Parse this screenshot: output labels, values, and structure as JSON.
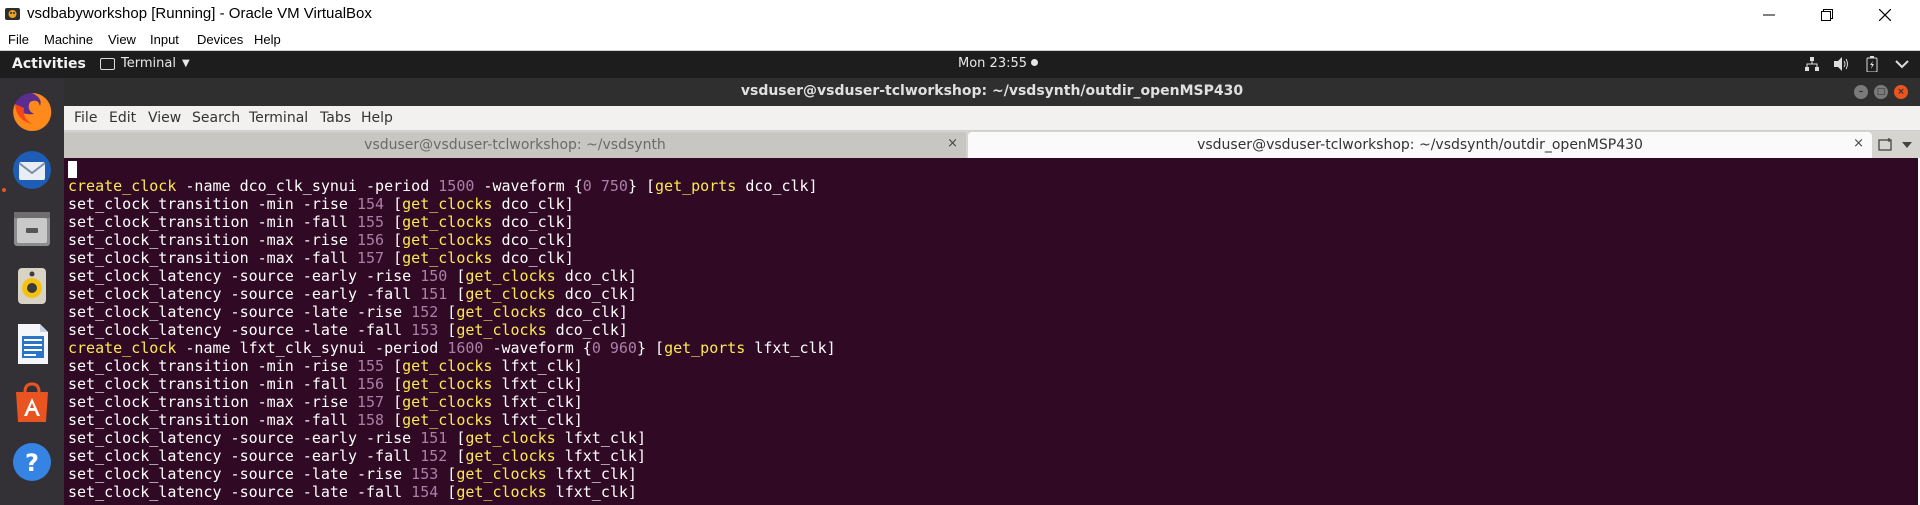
{
  "vbox": {
    "title": "vsdbabyworkshop [Running] - Oracle VM VirtualBox",
    "menu": [
      "File",
      "Machine",
      "View",
      "Input",
      "Devices",
      "Help"
    ]
  },
  "topbar": {
    "activities": "Activities",
    "app_menu": "Terminal",
    "clock": "Mon 23:55"
  },
  "dock": {
    "items": [
      "firefox-icon",
      "thunderbird-icon",
      "files-icon",
      "rhythmbox-icon",
      "libreoffice-writer-icon",
      "software-icon",
      "help-icon"
    ]
  },
  "terminal": {
    "window_title": "vsduser@vsduser-tclworkshop: ~/vsdsynth/outdir_openMSP430",
    "menu": [
      "File",
      "Edit",
      "View",
      "Search",
      "Terminal",
      "Tabs",
      "Help"
    ],
    "tabs": [
      {
        "label": "vsduser@vsduser-tclworkshop: ~/vsdsynth",
        "close": "×",
        "active": false
      },
      {
        "label": "vsduser@vsduser-tclworkshop: ~/vsdsynth/outdir_openMSP430",
        "close": "×",
        "active": true
      }
    ],
    "lines": [
      [
        {
          "t": "create_clock",
          "c": "cmd-kw"
        },
        {
          "t": " -name dco_clk_synui -period "
        },
        {
          "t": "1500",
          "c": "num"
        },
        {
          "t": " -waveform {"
        },
        {
          "t": "0 750",
          "c": "num"
        },
        {
          "t": "} ["
        },
        {
          "t": "get_ports",
          "c": "brk-kw"
        },
        {
          "t": " dco_clk]"
        }
      ],
      [
        {
          "t": "set_clock_transition -min -rise "
        },
        {
          "t": "154",
          "c": "num"
        },
        {
          "t": " ["
        },
        {
          "t": "get_clocks",
          "c": "brk-kw"
        },
        {
          "t": " dco_clk]"
        }
      ],
      [
        {
          "t": "set_clock_transition -min -fall "
        },
        {
          "t": "155",
          "c": "num"
        },
        {
          "t": " ["
        },
        {
          "t": "get_clocks",
          "c": "brk-kw"
        },
        {
          "t": " dco_clk]"
        }
      ],
      [
        {
          "t": "set_clock_transition -max -rise "
        },
        {
          "t": "156",
          "c": "num"
        },
        {
          "t": " ["
        },
        {
          "t": "get_clocks",
          "c": "brk-kw"
        },
        {
          "t": " dco_clk]"
        }
      ],
      [
        {
          "t": "set_clock_transition -max -fall "
        },
        {
          "t": "157",
          "c": "num"
        },
        {
          "t": " ["
        },
        {
          "t": "get_clocks",
          "c": "brk-kw"
        },
        {
          "t": " dco_clk]"
        }
      ],
      [
        {
          "t": "set_clock_latency -source -early -rise "
        },
        {
          "t": "150",
          "c": "num"
        },
        {
          "t": " ["
        },
        {
          "t": "get_clocks",
          "c": "brk-kw"
        },
        {
          "t": " dco_clk]"
        }
      ],
      [
        {
          "t": "set_clock_latency -source -early -fall "
        },
        {
          "t": "151",
          "c": "num"
        },
        {
          "t": " ["
        },
        {
          "t": "get_clocks",
          "c": "brk-kw"
        },
        {
          "t": " dco_clk]"
        }
      ],
      [
        {
          "t": "set_clock_latency -source -late -rise "
        },
        {
          "t": "152",
          "c": "num"
        },
        {
          "t": " ["
        },
        {
          "t": "get_clocks",
          "c": "brk-kw"
        },
        {
          "t": " dco_clk]"
        }
      ],
      [
        {
          "t": "set_clock_latency -source -late -fall "
        },
        {
          "t": "153",
          "c": "num"
        },
        {
          "t": " ["
        },
        {
          "t": "get_clocks",
          "c": "brk-kw"
        },
        {
          "t": " dco_clk]"
        }
      ],
      [
        {
          "t": "create_clock",
          "c": "cmd-kw"
        },
        {
          "t": " -name lfxt_clk_synui -period "
        },
        {
          "t": "1600",
          "c": "num"
        },
        {
          "t": " -waveform {"
        },
        {
          "t": "0 960",
          "c": "num"
        },
        {
          "t": "} ["
        },
        {
          "t": "get_ports",
          "c": "brk-kw"
        },
        {
          "t": " lfxt_clk]"
        }
      ],
      [
        {
          "t": "set_clock_transition -min -rise "
        },
        {
          "t": "155",
          "c": "num"
        },
        {
          "t": " ["
        },
        {
          "t": "get_clocks",
          "c": "brk-kw"
        },
        {
          "t": " lfxt_clk]"
        }
      ],
      [
        {
          "t": "set_clock_transition -min -fall "
        },
        {
          "t": "156",
          "c": "num"
        },
        {
          "t": " ["
        },
        {
          "t": "get_clocks",
          "c": "brk-kw"
        },
        {
          "t": " lfxt_clk]"
        }
      ],
      [
        {
          "t": "set_clock_transition -max -rise "
        },
        {
          "t": "157",
          "c": "num"
        },
        {
          "t": " ["
        },
        {
          "t": "get_clocks",
          "c": "brk-kw"
        },
        {
          "t": " lfxt_clk]"
        }
      ],
      [
        {
          "t": "set_clock_transition -max -fall "
        },
        {
          "t": "158",
          "c": "num"
        },
        {
          "t": " ["
        },
        {
          "t": "get_clocks",
          "c": "brk-kw"
        },
        {
          "t": " lfxt_clk]"
        }
      ],
      [
        {
          "t": "set_clock_latency -source -early -rise "
        },
        {
          "t": "151",
          "c": "num"
        },
        {
          "t": " ["
        },
        {
          "t": "get_clocks",
          "c": "brk-kw"
        },
        {
          "t": " lfxt_clk]"
        }
      ],
      [
        {
          "t": "set_clock_latency -source -early -fall "
        },
        {
          "t": "152",
          "c": "num"
        },
        {
          "t": " ["
        },
        {
          "t": "get_clocks",
          "c": "brk-kw"
        },
        {
          "t": " lfxt_clk]"
        }
      ],
      [
        {
          "t": "set_clock_latency -source -late -rise "
        },
        {
          "t": "153",
          "c": "num"
        },
        {
          "t": " ["
        },
        {
          "t": "get_clocks",
          "c": "brk-kw"
        },
        {
          "t": " lfxt_clk]"
        }
      ],
      [
        {
          "t": "set_clock_latency -source -late -fall "
        },
        {
          "t": "154",
          "c": "num"
        },
        {
          "t": " ["
        },
        {
          "t": "get_clocks",
          "c": "brk-kw"
        },
        {
          "t": " lfxt_clk]"
        }
      ]
    ]
  },
  "colors": {
    "terminal_bg": "#300a24",
    "keyword": "#fce94f",
    "number": "#ad7fa8",
    "ubuntu_orange": "#e95420"
  }
}
